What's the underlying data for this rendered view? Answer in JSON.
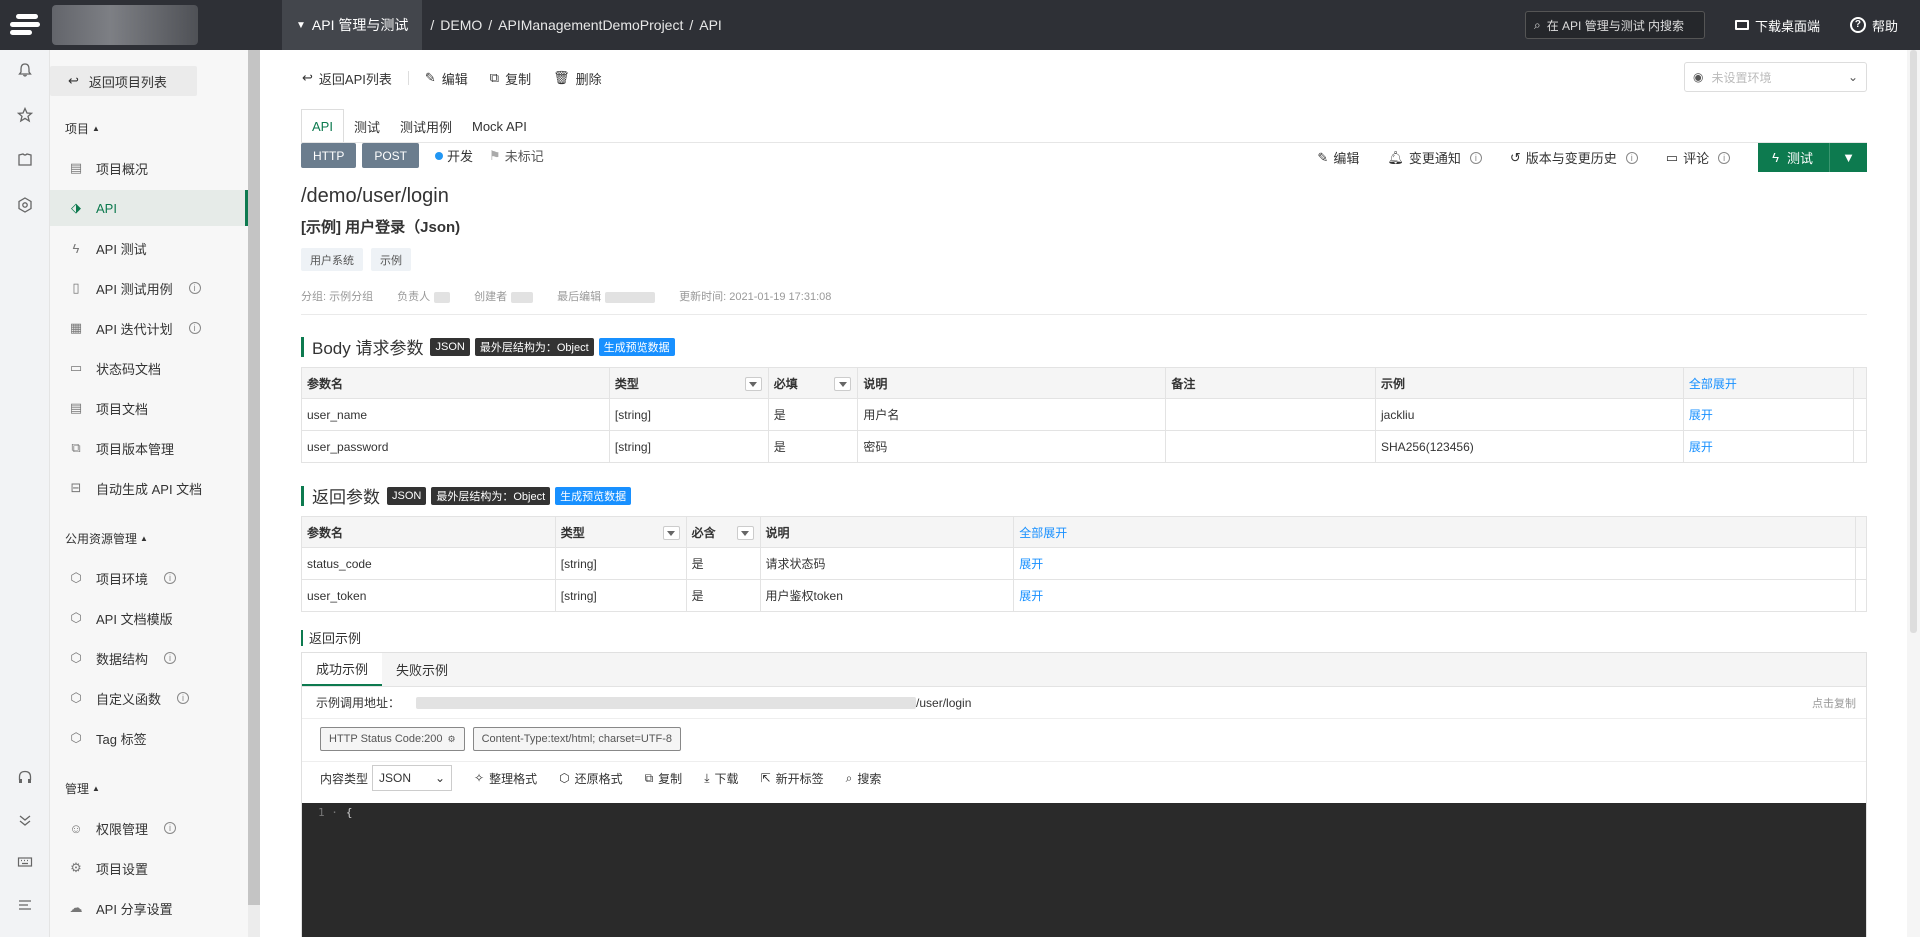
{
  "topbar": {
    "workspace": "API 管理与测试",
    "crumbs": [
      "/",
      "DEMO",
      "/",
      "APIManagementDemoProject",
      "/",
      "API"
    ],
    "search_placeholder": "在 API 管理与测试 内搜索",
    "download": "下载桌面端",
    "help": "帮助"
  },
  "sidebar": {
    "back": "返回项目列表",
    "sec_project": "项目",
    "items_project": [
      {
        "label": "项目概况",
        "icon": "dashboard-icon"
      },
      {
        "label": "API",
        "icon": "tag-icon"
      },
      {
        "label": "API 测试",
        "icon": "lightning-icon"
      },
      {
        "label": "API 测试用例",
        "icon": "clipboard-icon"
      },
      {
        "label": "API 迭代计划",
        "icon": "calendar-icon"
      },
      {
        "label": "状态码文档",
        "icon": "doc-icon"
      },
      {
        "label": "项目文档",
        "icon": "list-doc-icon"
      },
      {
        "label": "项目版本管理",
        "icon": "versions-icon"
      },
      {
        "label": "自动生成 API 文档",
        "icon": "robot-icon"
      }
    ],
    "sec_public": "公用资源管理",
    "items_public": [
      {
        "label": "项目环境",
        "icon": "cube-icon"
      },
      {
        "label": "API 文档模版",
        "icon": "cube-icon"
      },
      {
        "label": "数据结构",
        "icon": "cube-icon"
      },
      {
        "label": "自定义函数",
        "icon": "cube-icon"
      },
      {
        "label": "Tag 标签",
        "icon": "cube-icon"
      }
    ],
    "sec_manage": "管理",
    "items_manage": [
      {
        "label": "权限管理",
        "icon": "user-icon"
      },
      {
        "label": "项目设置",
        "icon": "gear-icon"
      },
      {
        "label": "API 分享设置",
        "icon": "cloud-icon"
      }
    ]
  },
  "toolbar": {
    "back": "返回API列表",
    "edit": "编辑",
    "copy": "复制",
    "delete": "删除",
    "env_placeholder": "未设置环境"
  },
  "tabs": [
    "API",
    "测试",
    "测试用例",
    "Mock API"
  ],
  "api": {
    "protocol": "HTTP",
    "method": "POST",
    "status": "开发",
    "flag": "未标记",
    "path": "/demo/user/login",
    "name": "[示例] 用户登录（Json)",
    "tags": [
      "用户系统",
      "示例"
    ],
    "meta_group": "分组: 示例分组",
    "meta_owner": "负责人",
    "meta_creator": "创建者",
    "meta_editor": "最后编辑",
    "meta_updated": "更新时间:  2021-01-19 17:31:08"
  },
  "actions": {
    "edit": "编辑",
    "notify": "变更通知",
    "history": "版本与变更历史",
    "comment": "评论",
    "test": "测试"
  },
  "body_params": {
    "title": "Body 请求参数",
    "label_json": "JSON",
    "label_outer": "最外层结构为：Object",
    "label_gen": "生成预览数据",
    "headers": [
      "参数名",
      "类型",
      "必填",
      "说明",
      "备注",
      "示例",
      "全部展开"
    ],
    "rows": [
      [
        "user_name",
        "[string]",
        "是",
        "用户名",
        "",
        "jackliu",
        "展开"
      ],
      [
        "user_password",
        "[string]",
        "是",
        "密码",
        "",
        "SHA256(123456)",
        "展开"
      ]
    ]
  },
  "resp_params": {
    "title": "返回参数",
    "label_json": "JSON",
    "label_outer": "最外层结构为：Object",
    "label_gen": "生成预览数据",
    "headers": [
      "参数名",
      "类型",
      "必含",
      "说明",
      "全部展开"
    ],
    "rows": [
      [
        "status_code",
        "[string]",
        "是",
        "请求状态码",
        "展开"
      ],
      [
        "user_token",
        "[string]",
        "是",
        "用户鉴权token",
        "展开"
      ]
    ]
  },
  "example": {
    "title": "返回示例",
    "tabs": [
      "成功示例",
      "失败示例"
    ],
    "url_label": "示例调用地址：",
    "url_suffix": "/user/login",
    "copy": "点击复制",
    "status_code": "HTTP Status Code:200",
    "content_type": "Content-Type:text/html; charset=UTF-8",
    "ctype_label": "内容类型",
    "ctype_value": "JSON",
    "tools": [
      "整理格式",
      "还原格式",
      "复制",
      "下载",
      "新开标签",
      "搜索"
    ],
    "code_line": "{"
  }
}
